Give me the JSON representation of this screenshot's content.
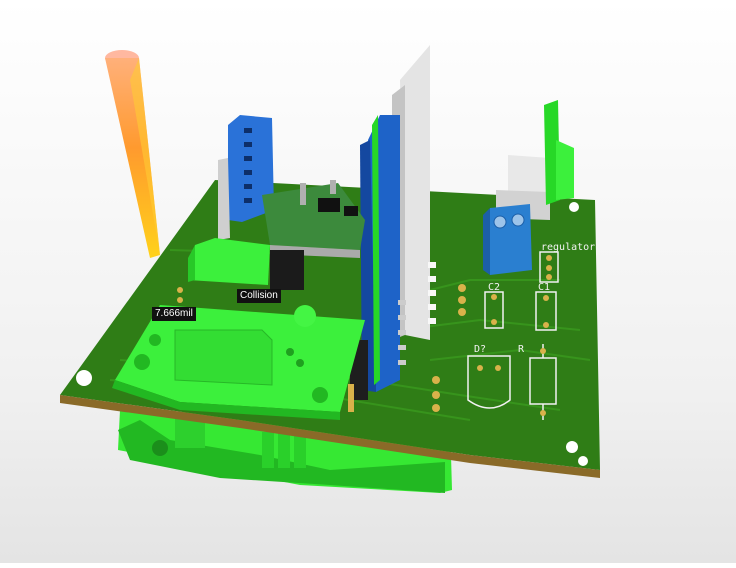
{
  "viewer": {
    "collision_label": "Collision",
    "distance_label": "7.666mil"
  },
  "board": {
    "silkscreen": {
      "regulator": "regulator",
      "c1": "C1",
      "c2": "C2",
      "diode": "D?",
      "resistor": "R"
    }
  },
  "colors": {
    "pcb": "#2f7d16",
    "pcb_dark": "#1f5a0c",
    "collision_green": "#33ee33",
    "connector_blue": "#1e63c8",
    "terminal_blue": "#2a7fd0",
    "plastic_white": "#e8e8e8",
    "pad_gold": "#d9b24a",
    "silkscreen": "#f2f2f2",
    "probe_orange": "#ff9a2e"
  }
}
